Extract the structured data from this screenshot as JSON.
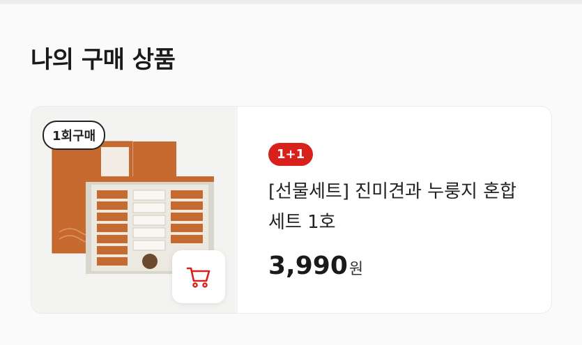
{
  "section": {
    "title": "나의 구매 상품"
  },
  "product": {
    "frequency_badge": "1회구매",
    "promo_badge": "1+1",
    "name": "[선물세트] 진미견과 누룽지 혼합 세트 1호",
    "price": "3,990",
    "currency": "원",
    "image": "gift-box-product-image",
    "cart_icon": "cart-icon",
    "accent_color": "#d9211c",
    "box_color": "#c76a2f"
  }
}
